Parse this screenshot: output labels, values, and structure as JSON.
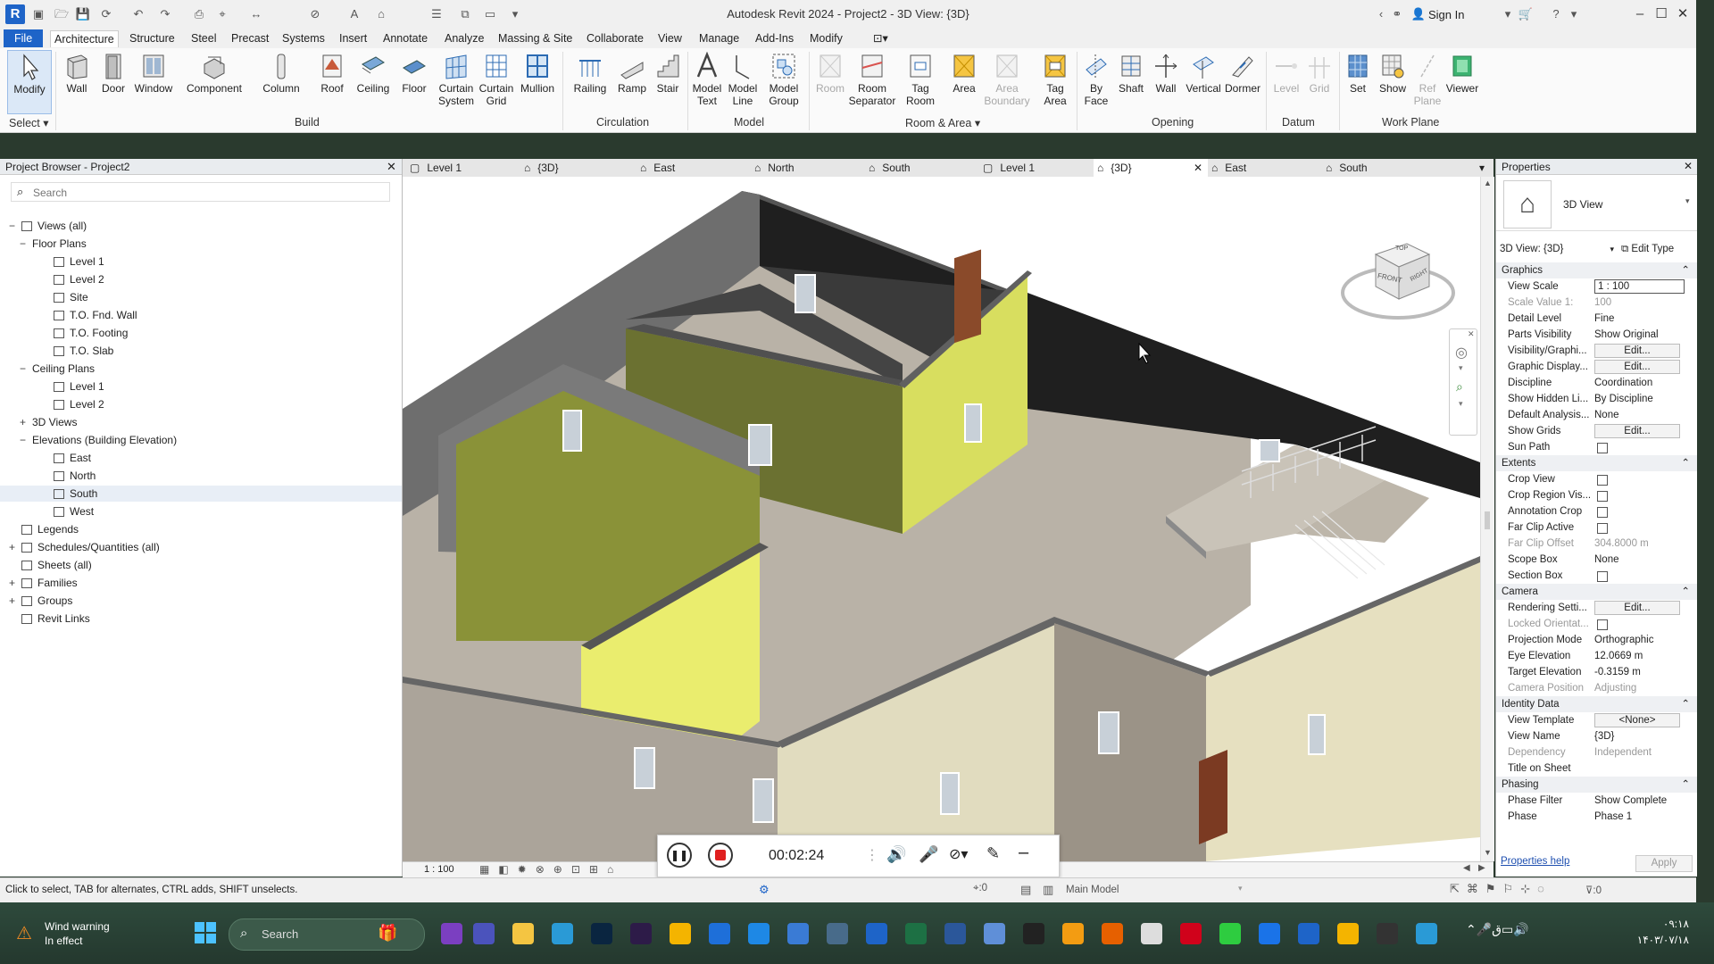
{
  "app": {
    "title": "Autodesk Revit 2024 - Project2 - 3D View: {3D}",
    "logo_letter": "R",
    "sign_in": "Sign In",
    "accent": "#1e64c8"
  },
  "menu": {
    "file": "File",
    "tabs": [
      "Architecture",
      "Structure",
      "Steel",
      "Precast",
      "Systems",
      "Insert",
      "Annotate",
      "Analyze",
      "Massing & Site",
      "Collaborate",
      "View",
      "Manage",
      "Add-Ins",
      "Modify"
    ]
  },
  "ribbon": {
    "buttons": {
      "modify": "Modify",
      "wall": "Wall",
      "door": "Door",
      "window": "Window",
      "component": "Component",
      "column": "Column",
      "roof": "Roof",
      "ceiling": "Ceiling",
      "floor": "Floor",
      "curtain_system": "Curtain System",
      "curtain_grid": "Curtain Grid",
      "mullion": "Mullion",
      "railing": "Railing",
      "ramp": "Ramp",
      "stair": "Stair",
      "model_text": "Model Text",
      "model_line": "Model Line",
      "model_group": "Model Group",
      "room": "Room",
      "room_separator": "Room Separator",
      "tag_room": "Tag Room",
      "area": "Area",
      "area_boundary": "Area Boundary",
      "tag_area": "Tag Area",
      "by_face": "By Face",
      "shaft": "Shaft",
      "wall_open": "Wall",
      "vertical": "Vertical",
      "dormer": "Dormer",
      "level": "Level",
      "grid": "Grid",
      "set": "Set",
      "show": "Show",
      "ref_plane": "Ref Plane",
      "viewer": "Viewer"
    },
    "panels": {
      "select": "Select",
      "build": "Build",
      "circulation": "Circulation",
      "model": "Model",
      "room_area": "Room & Area",
      "opening": "Opening",
      "datum": "Datum",
      "work_plane": "Work Plane"
    }
  },
  "browser": {
    "title": "Project Browser - Project2",
    "search_placeholder": "Search",
    "nodes": {
      "views": "Views (all)",
      "floor_plans": "Floor Plans",
      "fp_level1": "Level 1",
      "fp_level2": "Level 2",
      "fp_site": "Site",
      "fp_fnd": "T.O. Fnd. Wall",
      "fp_footing": "T.O. Footing",
      "fp_slab": "T.O. Slab",
      "ceiling_plans": "Ceiling Plans",
      "cp_level1": "Level 1",
      "cp_level2": "Level 2",
      "views3d": "3D Views",
      "elevations": "Elevations (Building Elevation)",
      "el_east": "East",
      "el_north": "North",
      "el_south": "South",
      "el_west": "West",
      "legends": "Legends",
      "schedules": "Schedules/Quantities (all)",
      "sheets": "Sheets (all)",
      "families": "Families",
      "groups": "Groups",
      "links": "Revit Links"
    }
  },
  "view_tabs": [
    "Level 1",
    "{3D}",
    "East",
    "North",
    "South",
    "Level 1",
    "{3D}",
    "East",
    "South"
  ],
  "viewcube": {
    "top": "TOP",
    "front": "FRONT",
    "right": "RIGHT"
  },
  "view_bar": {
    "scale": "1 : 100"
  },
  "properties": {
    "title": "Properties",
    "type_name": "3D View",
    "selector": "3D View: {3D}",
    "edit_type": "Edit Type",
    "help": "Properties help",
    "apply": "Apply",
    "sections": {
      "graphics": "Graphics",
      "extents": "Extents",
      "camera": "Camera",
      "identity": "Identity Data",
      "phasing": "Phasing"
    },
    "rows": {
      "view_scale_k": "View Scale",
      "view_scale_v": "1 : 100",
      "scale_value_k": "Scale Value    1:",
      "scale_value_v": "100",
      "detail_level_k": "Detail Level",
      "detail_level_v": "Fine",
      "parts_vis_k": "Parts Visibility",
      "parts_vis_v": "Show Original",
      "vis_graph_k": "Visibility/Graphi...",
      "vis_graph_v": "Edit...",
      "graph_disp_k": "Graphic Display...",
      "graph_disp_v": "Edit...",
      "discipline_k": "Discipline",
      "discipline_v": "Coordination",
      "hidden_lines_k": "Show Hidden Li...",
      "hidden_lines_v": "By Discipline",
      "default_analysis_k": "Default Analysis...",
      "default_analysis_v": "None",
      "show_grids_k": "Show Grids",
      "show_grids_v": "Edit...",
      "sun_path_k": "Sun Path",
      "crop_view_k": "Crop View",
      "crop_region_k": "Crop Region Vis...",
      "annotation_crop_k": "Annotation Crop",
      "far_clip_active_k": "Far Clip Active",
      "far_clip_offset_k": "Far Clip Offset",
      "far_clip_offset_v": "304.8000 m",
      "scope_box_k": "Scope Box",
      "scope_box_v": "None",
      "section_box_k": "Section Box",
      "rendering_k": "Rendering Setti...",
      "rendering_v": "Edit...",
      "locked_orient_k": "Locked Orientat...",
      "projection_k": "Projection Mode",
      "projection_v": "Orthographic",
      "eye_elev_k": "Eye Elevation",
      "eye_elev_v": "12.0669 m",
      "target_elev_k": "Target Elevation",
      "target_elev_v": "-0.3159 m",
      "camera_pos_k": "Camera Position",
      "camera_pos_v": "Adjusting",
      "view_template_k": "View Template",
      "view_template_v": "<None>",
      "view_name_k": "View Name",
      "view_name_v": "{3D}",
      "dependency_k": "Dependency",
      "dependency_v": "Independent",
      "title_sheet_k": "Title on Sheet",
      "phase_filter_k": "Phase Filter",
      "phase_filter_v": "Show Complete",
      "phase_k": "Phase",
      "phase_v": "Phase 1"
    }
  },
  "status": {
    "hint": "Click to select, TAB for alternates, CTRL adds, SHIFT unselects.",
    "zero": ":0",
    "model": "Main Model",
    "filter": ":0"
  },
  "recorder": {
    "time": "00:02:24"
  },
  "taskbar": {
    "weather_line1": "Wind warning",
    "weather_line2": "In effect",
    "search": "Search",
    "time": "۰۹:۱۸",
    "date": "۱۴۰۳/۰۷/۱۸"
  }
}
